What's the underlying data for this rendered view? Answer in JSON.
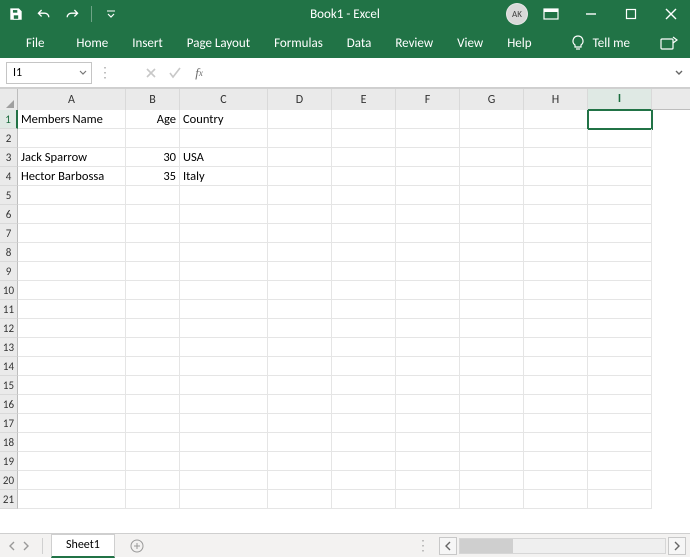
{
  "title": "Book1  -  Excel",
  "user_initials": "AK",
  "tabs": [
    "File",
    "Home",
    "Insert",
    "Page Layout",
    "Formulas",
    "Data",
    "Review",
    "View",
    "Help"
  ],
  "tell_me": "Tell me",
  "namebox_value": "I1",
  "formula_value": "",
  "columns": [
    "A",
    "B",
    "C",
    "D",
    "E",
    "F",
    "G",
    "H",
    "I"
  ],
  "selected_col_index": 8,
  "selected_row_index": 0,
  "row_count": 21,
  "cells": {
    "r1": {
      "A": "Members Name",
      "B": "Age",
      "C": "Country"
    },
    "r3": {
      "A": "Jack Sparrow",
      "B": "30",
      "C": "USA"
    },
    "r4": {
      "A": "Hector Barbossa",
      "B": "35",
      "C": "Italy"
    }
  },
  "numeric_cols": [
    "B"
  ],
  "sheet_tab": "Sheet1"
}
